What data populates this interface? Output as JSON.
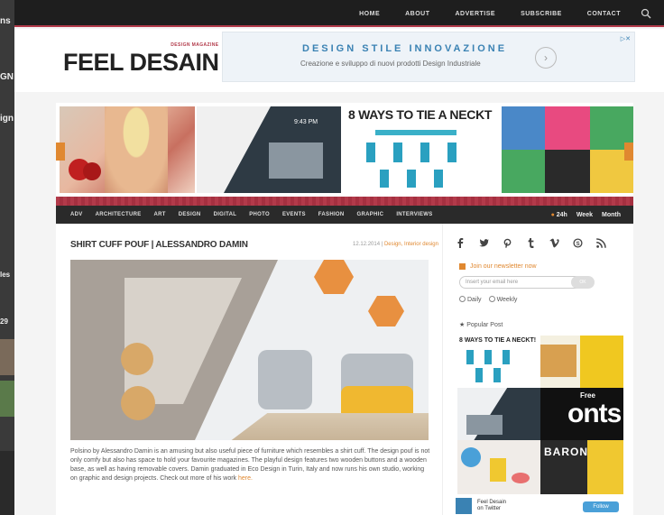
{
  "background_window": {
    "snippets": [
      "ns",
      "GN",
      "ign",
      "les",
      "29"
    ]
  },
  "topnav": {
    "links": [
      "HOME",
      "ABOUT",
      "ADVERTISE",
      "SUBSCRIBE",
      "CONTACT"
    ]
  },
  "header": {
    "logo": "FEEL DESAIN",
    "logo_tag": "DESIGN MAGAZINE"
  },
  "ad": {
    "title": "DESIGN STILE INNOVAZIONE",
    "subtitle": "Creazione e sviluppo di nuovi prodotti Design Industriale"
  },
  "slider": {
    "tie_title": "8 WAYS TO TIE A NECKT"
  },
  "catnav": {
    "items": [
      "ADV",
      "ARCHITECTURE",
      "ART",
      "DESIGN",
      "DIGITAL",
      "PHOTO",
      "EVENTS",
      "FASHION",
      "GRAPHIC",
      "INTERVIEWS"
    ],
    "count": "24h",
    "week": "Week",
    "month": "Month"
  },
  "post": {
    "title": "SHIRT CUFF POUF | ALESSANDRO DAMIN",
    "date": "12.12.2014 |",
    "categories": "Design, Interior design",
    "body": "Polsino by Alessandro Damin is an amusing but also useful piece of furniture which resembles a shirt cuff. The design pouf is not only comfy but also has space to hold your favourite magazines. The playful design features two wooden buttons and a wooden base, as well as having removable covers. Damin graduated in Eco Design in Turin, Italy and now runs his own studio, working on graphic and design projects. Check out more of his work",
    "more_link": "here."
  },
  "sidebar": {
    "newsletter": "Join our newsletter now",
    "email_placeholder": "Insert your email here",
    "email_button": "OK",
    "check_daily": "Daily",
    "check_weekly": "Weekly",
    "popular_title": "Popular Post",
    "popular_tie": "8 WAYS TO TIE A NECKT!",
    "popular_fonts_free": "Free",
    "popular_fonts": "onts",
    "popular_baron": "BARON",
    "twitter_name": "Feel Desain",
    "twitter_sub": "on Twitter",
    "follow": "Follow"
  },
  "colors": {
    "accent_orange": "#e08830",
    "accent_red": "#b23a4a",
    "nav_dark": "#1e1e1e",
    "ad_blue": "#3a82b3"
  },
  "icons": [
    "search-icon",
    "facebook-icon",
    "twitter-icon",
    "pinterest-icon",
    "tumblr-icon",
    "vimeo-icon",
    "skype-icon",
    "rss-icon",
    "newsletter-icon"
  ]
}
